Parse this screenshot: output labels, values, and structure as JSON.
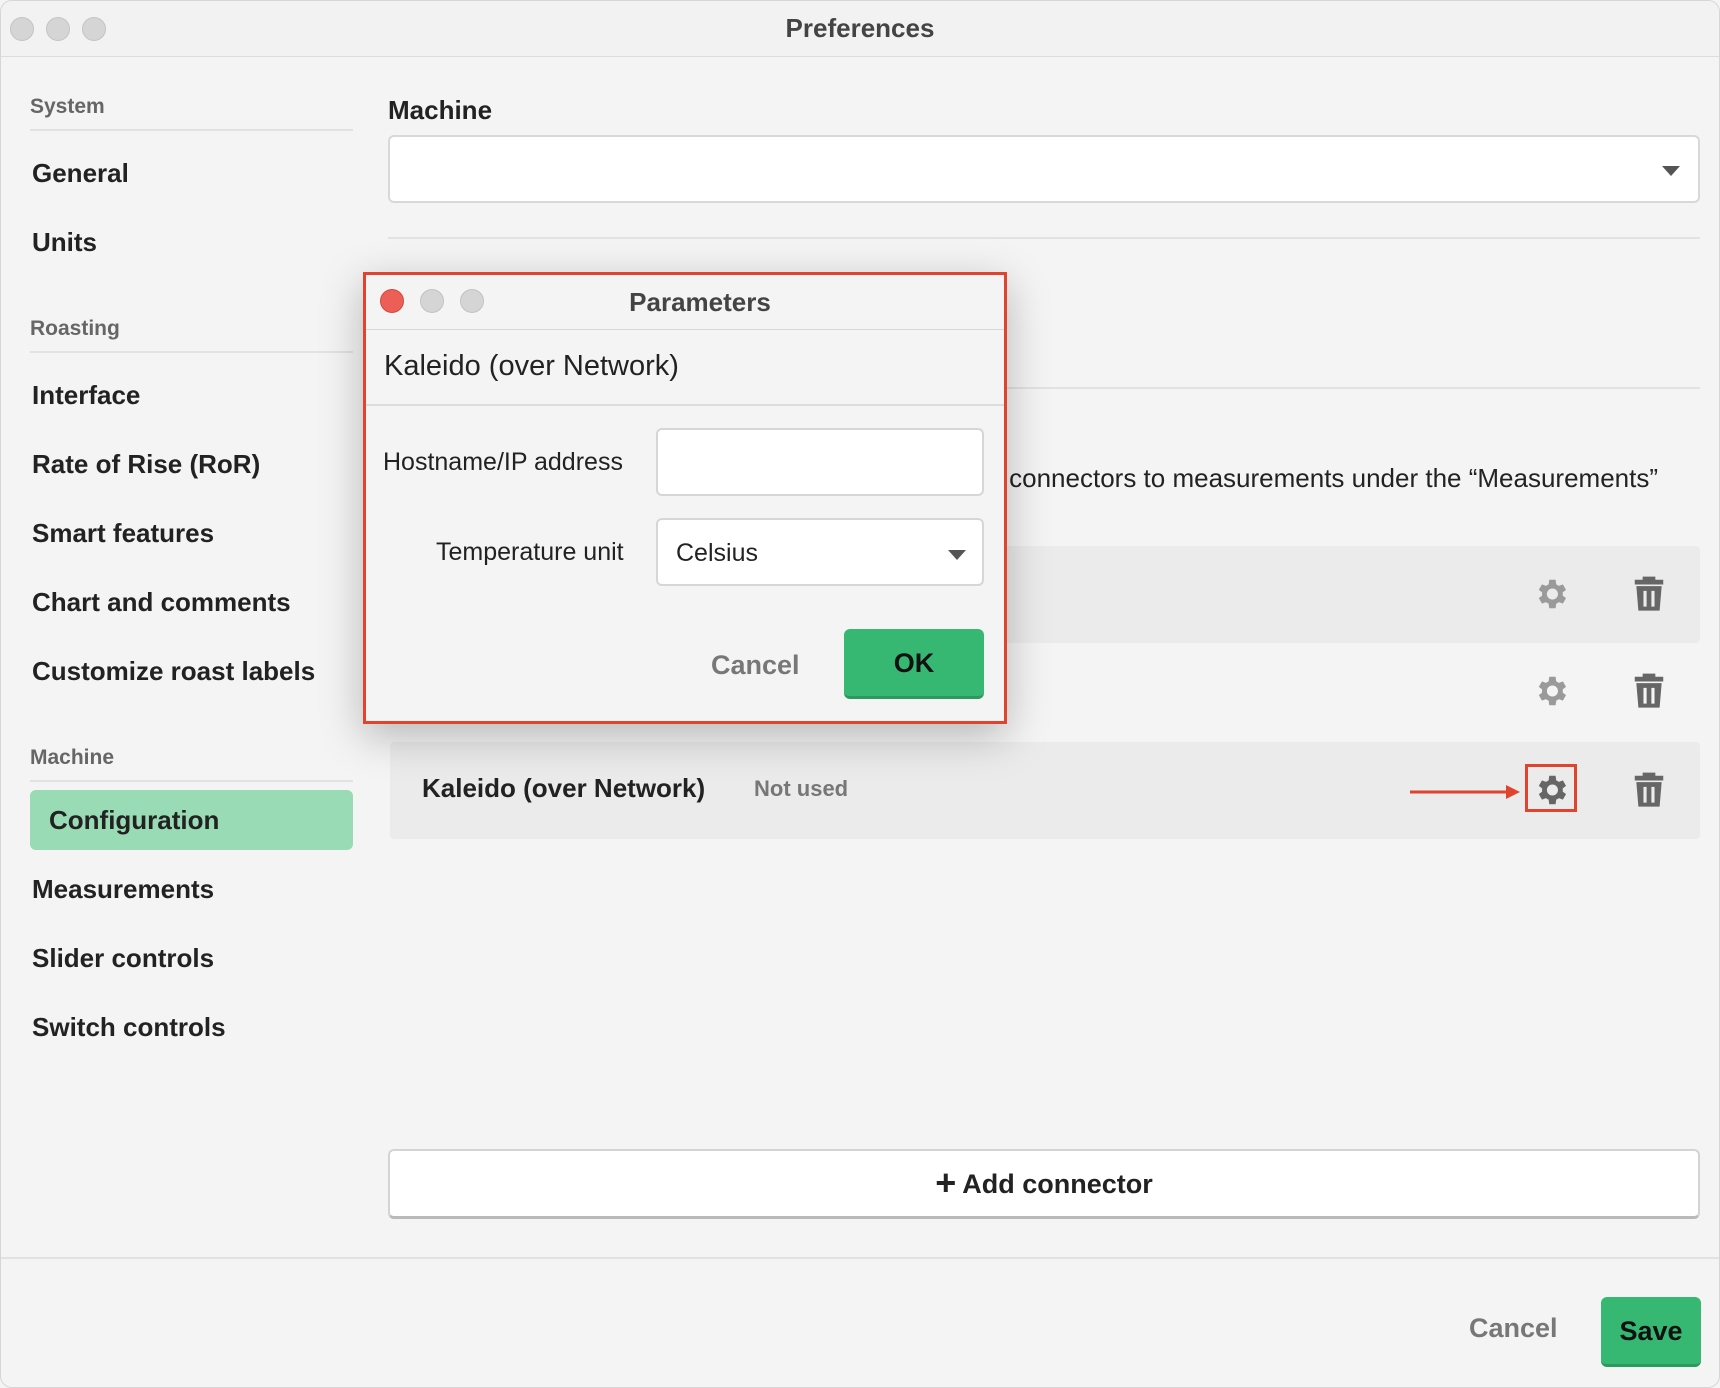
{
  "window": {
    "title": "Preferences"
  },
  "sidebar": {
    "sections": [
      {
        "heading": "System",
        "items": [
          "General",
          "Units"
        ]
      },
      {
        "heading": "Roasting",
        "items": [
          "Interface",
          "Rate of Rise (RoR)",
          "Smart features",
          "Chart and comments",
          "Customize roast labels"
        ]
      },
      {
        "heading": "Machine",
        "items": [
          "Configuration",
          "Measurements",
          "Slider controls",
          "Switch controls"
        ]
      }
    ],
    "active_item": "Configuration"
  },
  "main": {
    "machine_label": "Machine",
    "machine_select_value": "",
    "description_visible": "connectors to measurements under the “Measurements”",
    "connectors": [
      {
        "name": "",
        "status": ""
      },
      {
        "name": "",
        "status": ""
      },
      {
        "name": "Kaleido (over Network)",
        "status": "Not used"
      }
    ],
    "add_connector_label": "Add connector"
  },
  "footer": {
    "cancel_label": "Cancel",
    "save_label": "Save"
  },
  "dialog": {
    "title": "Parameters",
    "header": "Kaleido (over Network)",
    "hostname_label": "Hostname/IP address",
    "hostname_value": "",
    "temp_unit_label": "Temperature unit",
    "temp_unit_value": "Celsius",
    "cancel_label": "Cancel",
    "ok_label": "OK"
  },
  "colors": {
    "accent_green": "#36b873",
    "active_nav": "#98dbb5",
    "highlight_red": "#e2432e"
  },
  "icons": [
    "gear-icon",
    "trash-icon",
    "plus-icon",
    "chevron-down-icon",
    "arrow-right-icon"
  ]
}
